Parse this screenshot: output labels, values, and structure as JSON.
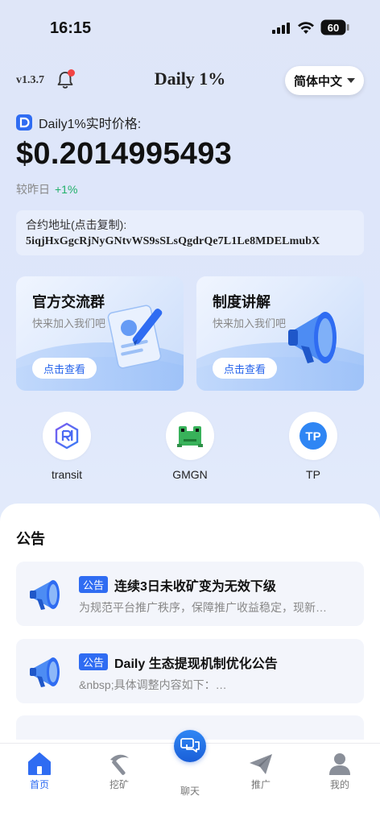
{
  "status_bar": {
    "time": "16:15",
    "battery": "60"
  },
  "header": {
    "version": "v1.3.7",
    "title": "Daily 1%",
    "language": "简体中文"
  },
  "price": {
    "label": "Daily1%实时价格:",
    "value": "$0.2014995493",
    "compare_label": "较昨日",
    "change": "+1%"
  },
  "contract": {
    "label": "合约地址(点击复制):",
    "address": "5iqjHxGgcRjNyGNtvWS9sSLsQgdrQe7L1Le8MDELmubX"
  },
  "cards": [
    {
      "title": "官方交流群",
      "subtitle": "快来加入我们吧",
      "button": "点击查看"
    },
    {
      "title": "制度讲解",
      "subtitle": "快来加入我们吧",
      "button": "点击查看"
    }
  ],
  "links": [
    {
      "label": "transit",
      "icon": "transit-logo-icon"
    },
    {
      "label": "GMGN",
      "icon": "gmgn-frog-icon"
    },
    {
      "label": "TP",
      "icon": "tp-logo-icon",
      "badge": "TP"
    }
  ],
  "announcements": {
    "title": "公告",
    "items": [
      {
        "tag": "公告",
        "title": "连续3日未收矿变为无效下级",
        "desc": "为规范平台推广秩序，保障推广收益稳定，现新…"
      },
      {
        "tag": "公告",
        "title": "Daily 生态提现机制优化公告",
        "desc": "&nbsp;具体调整内容如下：…"
      }
    ]
  },
  "tabbar": [
    {
      "label": "首页",
      "icon": "home-icon",
      "active": true
    },
    {
      "label": "挖矿",
      "icon": "pickaxe-icon"
    },
    {
      "label": "聊天",
      "icon": "chat-icon"
    },
    {
      "label": "推广",
      "icon": "paper-plane-icon"
    },
    {
      "label": "我的",
      "icon": "person-icon"
    }
  ],
  "colors": {
    "accent": "#2f6cf2",
    "up": "#21b06b",
    "badge_red": "#f24444"
  }
}
